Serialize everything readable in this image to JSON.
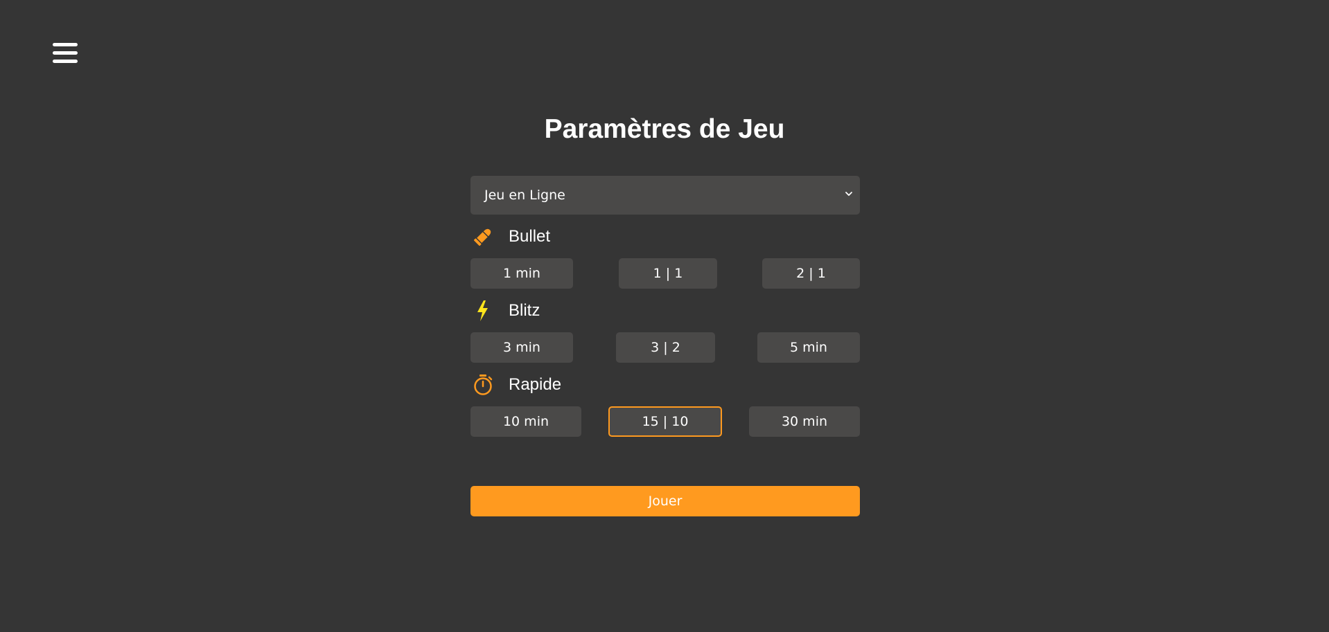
{
  "header": {
    "menu_icon": "hamburger-icon",
    "title": "Paramètres de Jeu"
  },
  "mode_select": {
    "value": "Jeu en Ligne",
    "icon": "chevron-down-icon"
  },
  "sections": {
    "bullet": {
      "label": "Bullet",
      "icon": "bullet-icon",
      "icon_color": "#ff9a1f",
      "options": [
        "1 min",
        "1 | 1",
        "2 | 1"
      ]
    },
    "blitz": {
      "label": "Blitz",
      "icon": "lightning-icon",
      "icon_color": "#ffe51c",
      "options": [
        "3 min",
        "3 | 2",
        "5 min"
      ]
    },
    "rapid": {
      "label": "Rapide",
      "icon": "stopwatch-icon",
      "icon_color": "#ff9a1f",
      "options": [
        "10 min",
        "15 | 10",
        "30 min"
      ],
      "selected": "15 | 10"
    }
  },
  "play_button": {
    "label": "Jouer"
  },
  "colors": {
    "background": "#353535",
    "surface": "#4a4948",
    "accent": "#ff9a1f",
    "text": "#ffffff"
  }
}
